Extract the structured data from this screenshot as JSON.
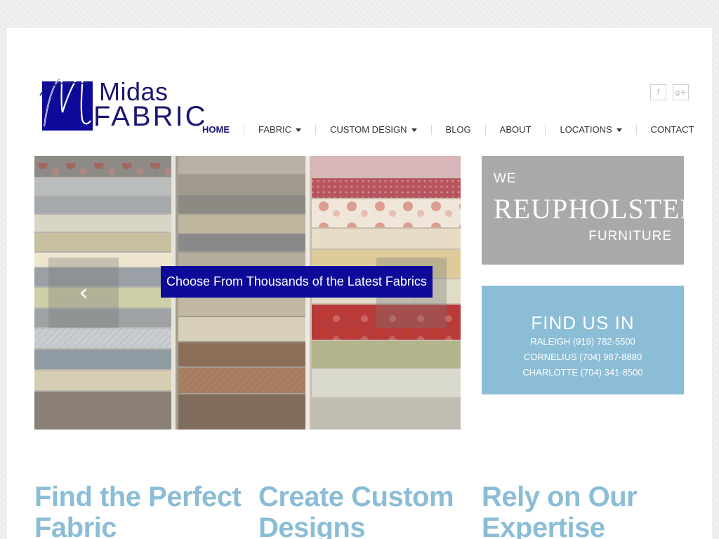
{
  "brand": {
    "logo_top": "Midas",
    "logo_bottom": "FABRIC",
    "primary_color": "#0d0a9a",
    "accent_color": "#8bbdd6"
  },
  "social": {
    "facebook_icon": "f",
    "googleplus_icon": "g+"
  },
  "nav": {
    "items": [
      {
        "label": "HOME",
        "active": true,
        "dropdown": false
      },
      {
        "label": "FABRIC",
        "dropdown": true
      },
      {
        "label": "CUSTOM DESIGN",
        "dropdown": true
      },
      {
        "label": "BLOG",
        "dropdown": false
      },
      {
        "label": "ABOUT",
        "dropdown": false
      },
      {
        "label": "LOCATIONS",
        "dropdown": true
      },
      {
        "label": "CONTACT",
        "dropdown": false
      }
    ]
  },
  "slider": {
    "caption": "Choose From Thousands of the Latest Fabrics",
    "prev_icon": "‹",
    "next_icon": "›"
  },
  "promo_reupholster": {
    "line1": "WE",
    "line2": "REUPHOLSTER",
    "line3": "FURNITURE"
  },
  "promo_locations": {
    "title": "FIND US IN",
    "lines": [
      "RALEIGH (919) 782-5500",
      "CORNELIUS (704) 987-8880",
      "CHARLOTTE (704) 341-8500"
    ]
  },
  "features": [
    "Find the Perfect Fabric",
    "Create Custom Designs",
    "Rely on Our Expertise"
  ]
}
